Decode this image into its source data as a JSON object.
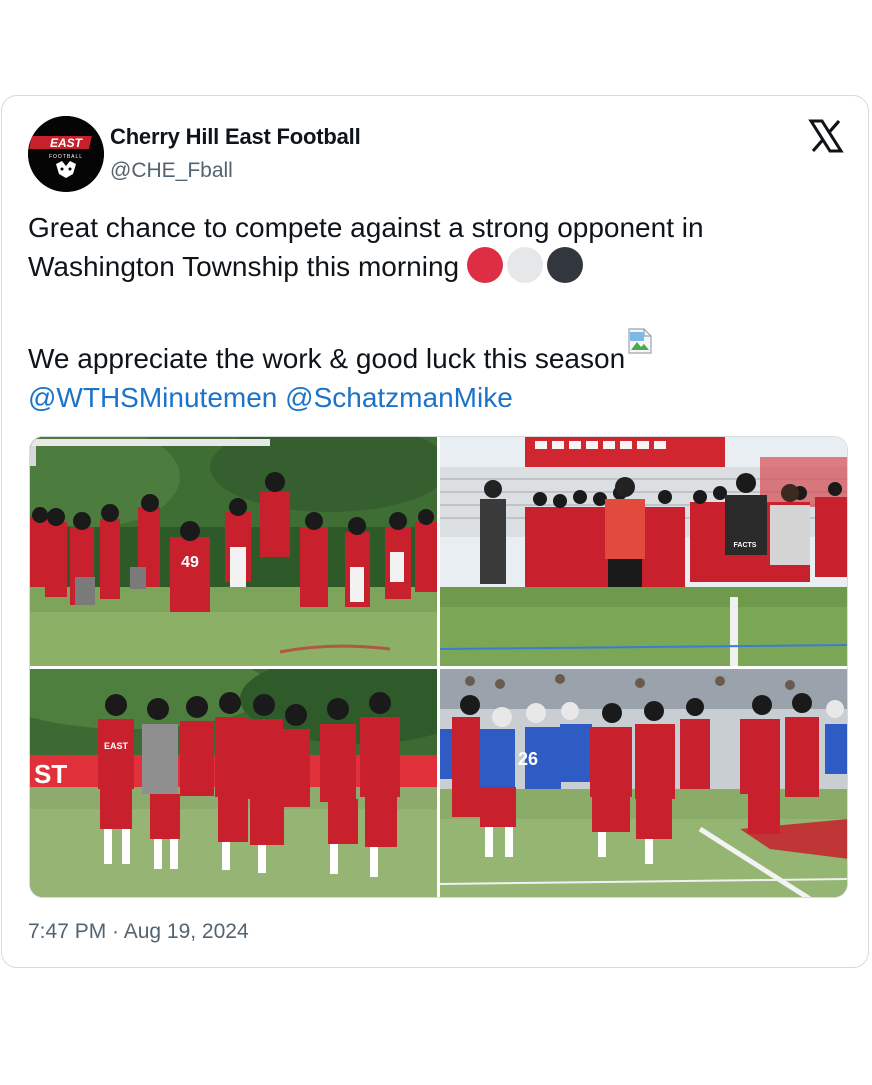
{
  "tweet": {
    "author_name": "Cherry Hill East Football",
    "author_handle": "@CHE_Fball",
    "avatar_text_top": "EAST",
    "avatar_text_bottom": "FOOTBALL",
    "text_line1": "Great chance to compete against a strong opponent in",
    "text_line2": "Washington Township this morning",
    "text_line3": "We appreciate the work & good luck this season",
    "mention1": "@WTHSMinutemen",
    "mention2": "@SchatzmanMike",
    "emoji_circles": [
      "red-circle",
      "white-circle",
      "black-circle"
    ],
    "timestamp": "7:47 PM · Aug 19, 2024"
  },
  "media": {
    "photos": [
      {
        "name": "photo-team-warmup",
        "jersey_number": "49"
      },
      {
        "name": "photo-coaches-huddle",
        "shirt_text": "FACTS"
      },
      {
        "name": "photo-players-standing",
        "shirt_text": "EAST",
        "sign_text": "ST"
      },
      {
        "name": "photo-scrimmage",
        "jersey_number": "26"
      }
    ]
  },
  "colors": {
    "team_red": "#c8202c",
    "opponent_blue": "#2f5cc4",
    "link_blue": "#1d73c8",
    "grass": "#7ea35a"
  },
  "icons": [
    "x-logo-icon",
    "broken-image-icon"
  ]
}
